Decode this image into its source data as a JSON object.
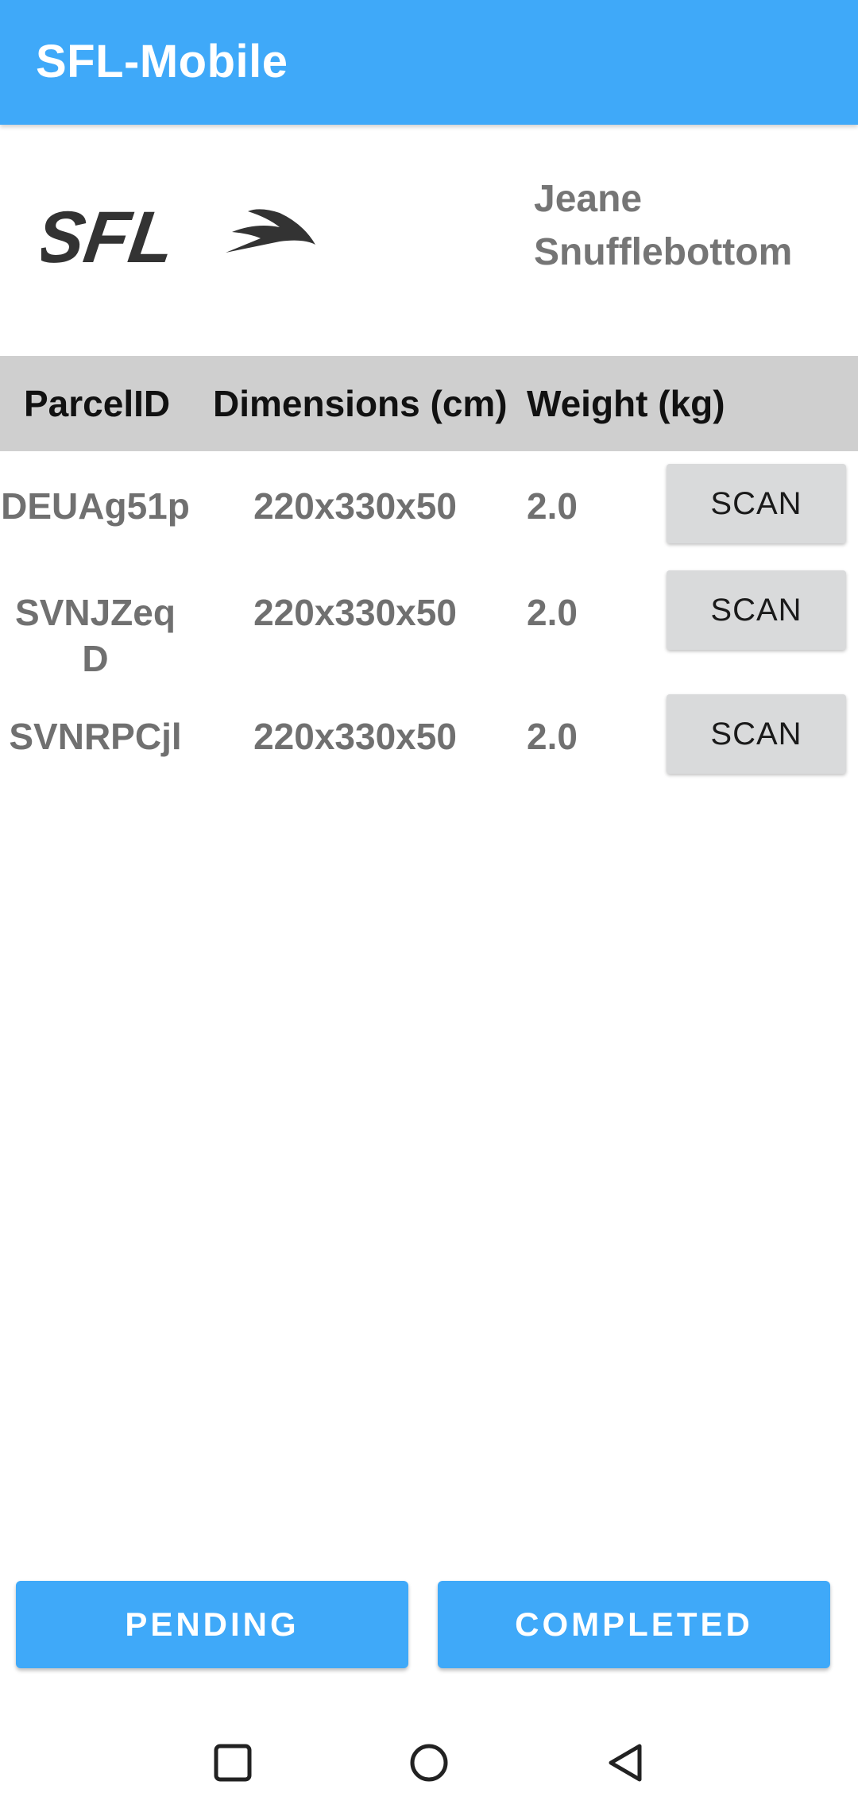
{
  "app_bar": {
    "title": "SFL-Mobile"
  },
  "brand": {
    "logo_text": "SFL",
    "user_name_line1": "Jeane",
    "user_name_line2": "Snufflebottom"
  },
  "table": {
    "headers": [
      "ParcelID",
      "Dimensions (cm)",
      "Weight (kg)"
    ],
    "rows": [
      {
        "parcel_id": "DEUAg51p",
        "dimensions": "220x330x50",
        "weight": "2.0",
        "action": "SCAN"
      },
      {
        "parcel_id": "SVNJZeqD",
        "dimensions": "220x330x50",
        "weight": "2.0",
        "action": "SCAN"
      },
      {
        "parcel_id": "SVNRPCjl",
        "dimensions": "220x330x50",
        "weight": "2.0",
        "action": "SCAN"
      }
    ]
  },
  "bottom_tabs": {
    "pending_label": "PENDING",
    "completed_label": "COMPLETED"
  },
  "nav_bar": {
    "icons": [
      "recents-square-icon",
      "home-circle-icon",
      "back-triangle-icon"
    ]
  },
  "colors": {
    "accent": "#3fa9f9",
    "header_gray": "#cfcfcf",
    "button_gray": "#d9dadb",
    "text_gray": "#707070"
  }
}
